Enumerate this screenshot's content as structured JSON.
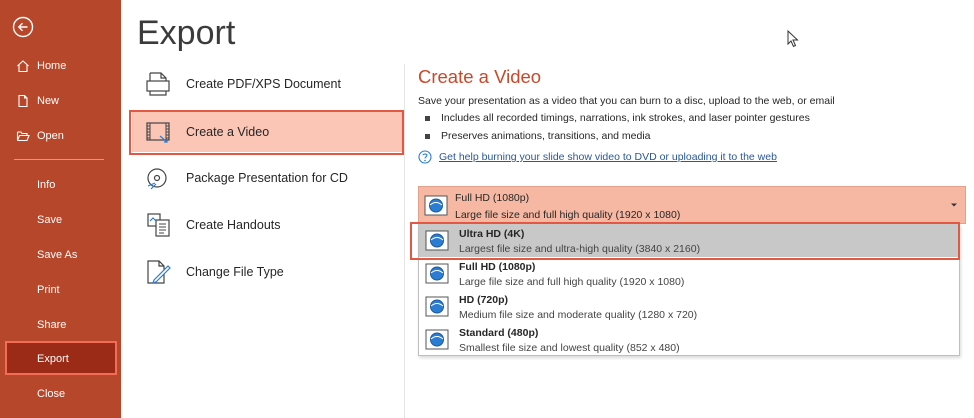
{
  "rail": {
    "back_icon": "back-arrow-icon",
    "items": [
      {
        "label": "Home",
        "icon": "home-icon"
      },
      {
        "label": "New",
        "icon": "new-document-icon"
      },
      {
        "label": "Open",
        "icon": "folder-open-icon"
      },
      {
        "label": "Info"
      },
      {
        "label": "Save"
      },
      {
        "label": "Save As"
      },
      {
        "label": "Print"
      },
      {
        "label": "Share"
      },
      {
        "label": "Export"
      },
      {
        "label": "Close"
      }
    ],
    "selected": "Export",
    "colors": {
      "background": "#b7472a",
      "selected": "#9b2b16"
    }
  },
  "page": {
    "title": "Export"
  },
  "options": [
    {
      "label": "Create PDF/XPS Document",
      "icon": "pdf-document-icon"
    },
    {
      "label": "Create a Video",
      "icon": "video-film-icon"
    },
    {
      "label": "Package Presentation for CD",
      "icon": "cd-package-icon"
    },
    {
      "label": "Create Handouts",
      "icon": "handouts-icon"
    },
    {
      "label": "Change File Type",
      "icon": "change-file-type-icon"
    }
  ],
  "detail": {
    "title": "Create a Video",
    "description": "Save your presentation as a video that you can burn to a disc, upload to the web, or email",
    "bullets": [
      "Includes all recorded timings, narrations, ink strokes, and laser pointer gestures",
      "Preserves animations, transitions, and media"
    ],
    "help_link": "Get help burning your slide show video to DVD or uploading it to the web",
    "accent": "#c8492a"
  },
  "quality": {
    "selected": {
      "title": "Full HD (1080p)",
      "subtitle": "Large file size and full high quality (1920 x 1080)"
    },
    "options": [
      {
        "title": "Ultra HD (4K)",
        "subtitle": "Largest file size and ultra-high quality (3840 x 2160)"
      },
      {
        "title": "Full HD (1080p)",
        "subtitle": "Large file size and full high quality (1920 x 1080)"
      },
      {
        "title": "HD (720p)",
        "subtitle": "Medium file size and moderate quality (1280 x 720)"
      },
      {
        "title": "Standard (480p)",
        "subtitle": "Smallest file size and lowest quality (852 x 480)"
      }
    ],
    "hovered": "Ultra HD (4K)"
  }
}
